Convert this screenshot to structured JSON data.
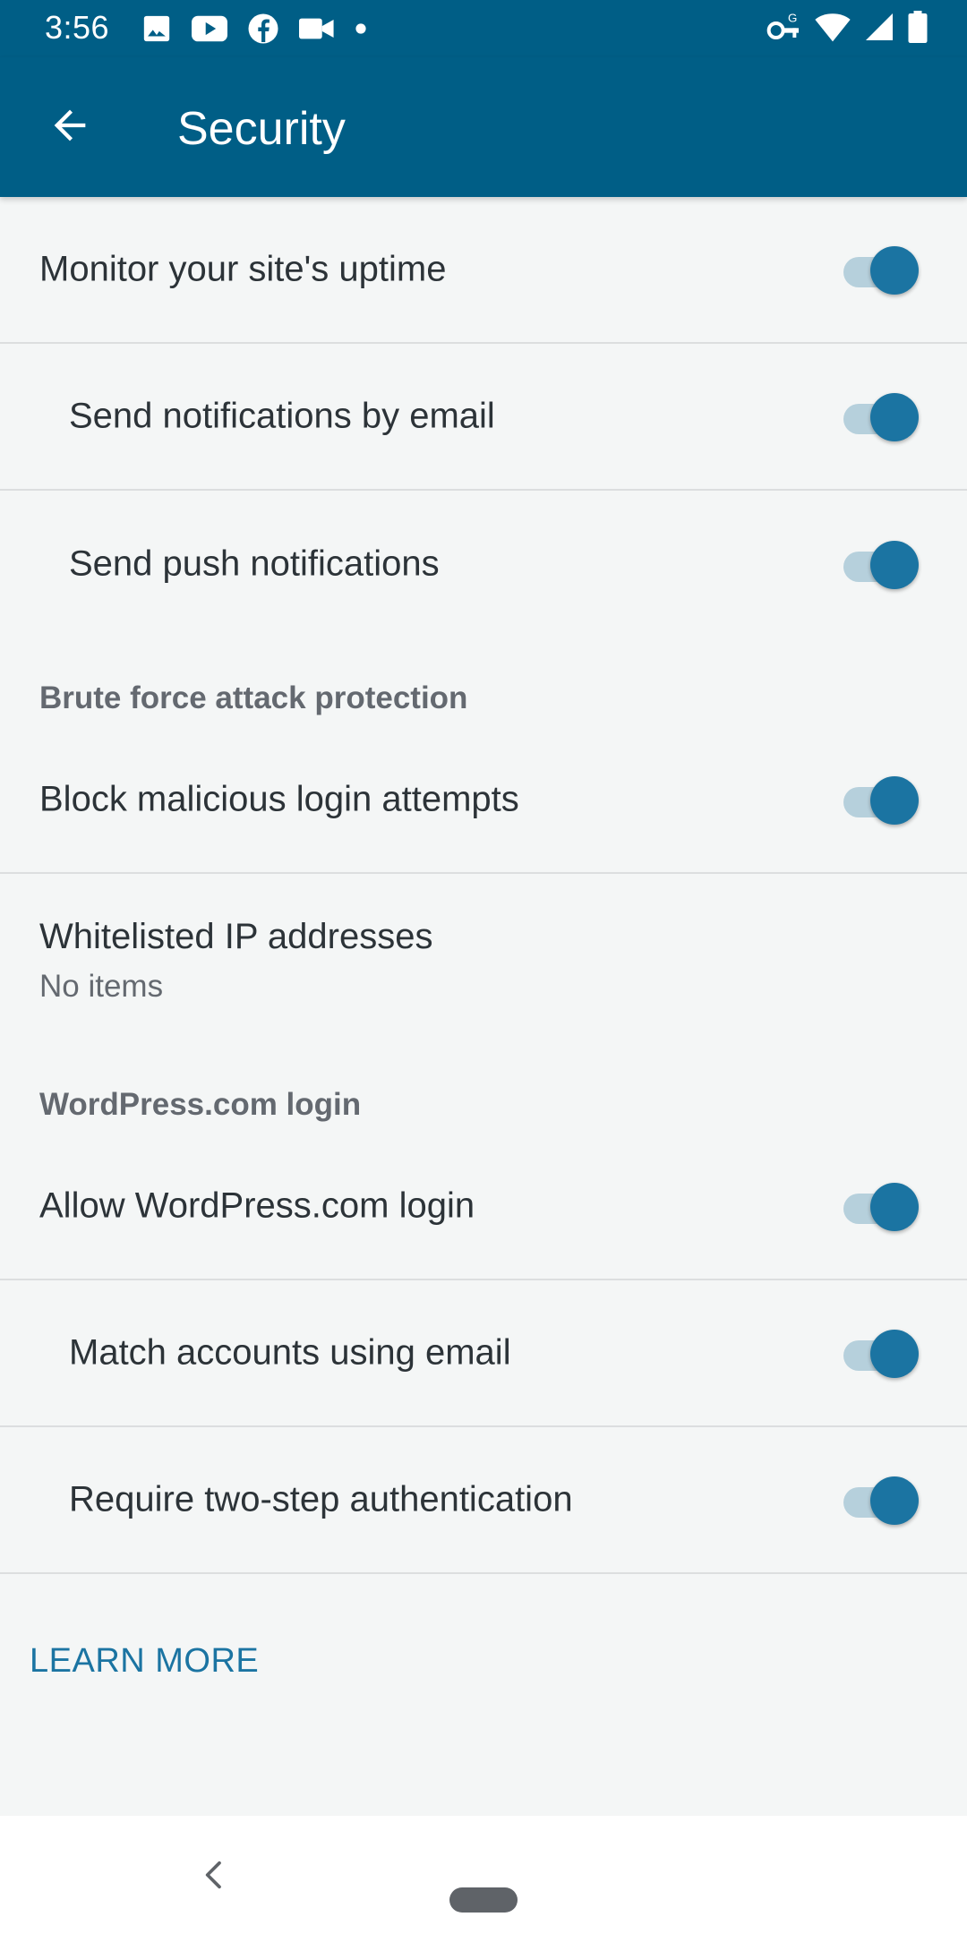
{
  "status_bar": {
    "time": "3:56",
    "left_icons": [
      "image-icon",
      "youtube-icon",
      "facebook-icon",
      "video-icon",
      "dot-icon"
    ],
    "right_icons": [
      "vpn-key-icon",
      "wifi-icon",
      "cell-signal-icon",
      "battery-icon"
    ]
  },
  "appbar": {
    "title": "Security"
  },
  "rows": {
    "monitor_uptime": {
      "label": "Monitor your site's uptime",
      "on": true
    },
    "email_notifications": {
      "label": "Send notifications by email",
      "on": true
    },
    "push_notifications": {
      "label": "Send push notifications",
      "on": true
    },
    "brute_force_header": "Brute force attack protection",
    "block_malicious": {
      "label": "Block malicious login attempts",
      "on": true
    },
    "whitelist": {
      "label": "Whitelisted IP addresses",
      "sublabel": "No items"
    },
    "wpcom_header": "WordPress.com login",
    "allow_wpcom": {
      "label": "Allow WordPress.com login",
      "on": true
    },
    "match_accounts": {
      "label": "Match accounts using email",
      "on": true
    },
    "two_step": {
      "label": "Require two-step authentication",
      "on": true
    }
  },
  "learn_more": "LEARN MORE",
  "colors": {
    "primary": "#005e86",
    "accent": "#1b74a2"
  }
}
